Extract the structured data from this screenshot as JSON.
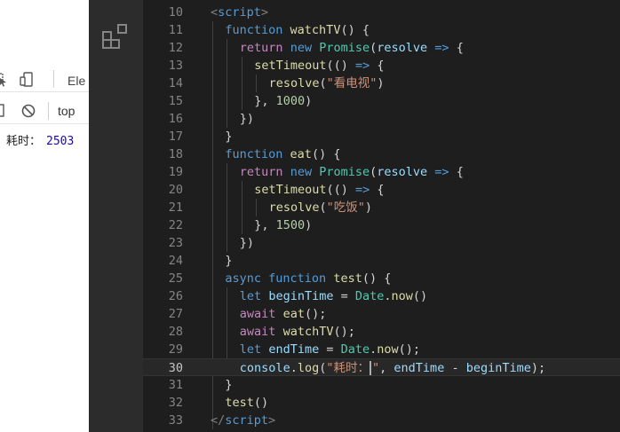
{
  "devtools": {
    "tab_label": "Ele",
    "context_label": "top",
    "console_label": "耗时：",
    "console_value": "2503"
  },
  "editor": {
    "lines": [
      {
        "n": "10",
        "tokens": [
          [
            "tag",
            "<"
          ],
          [
            "tagname",
            "script"
          ],
          [
            "tag",
            ">"
          ]
        ]
      },
      {
        "n": "11",
        "tokens": [
          [
            "kw",
            "function "
          ],
          [
            "fn",
            "watchTV"
          ],
          [
            "pun",
            "() {"
          ]
        ]
      },
      {
        "n": "12",
        "tokens": [
          [
            "ctrl",
            "return "
          ],
          [
            "kw",
            "new "
          ],
          [
            "cls",
            "Promise"
          ],
          [
            "pun",
            "("
          ],
          [
            "var",
            "resolve"
          ],
          [
            "kw",
            " => "
          ],
          [
            "pun",
            "{"
          ]
        ]
      },
      {
        "n": "13",
        "tokens": [
          [
            "fn",
            "setTimeout"
          ],
          [
            "pun",
            "(() "
          ],
          [
            "kw",
            "=>"
          ],
          [
            "pun",
            " {"
          ]
        ]
      },
      {
        "n": "14",
        "tokens": [
          [
            "fn",
            "resolve"
          ],
          [
            "pun",
            "("
          ],
          [
            "str",
            "\"看电视\""
          ],
          [
            "pun",
            ")"
          ]
        ]
      },
      {
        "n": "15",
        "tokens": [
          [
            "pun",
            "}, "
          ],
          [
            "num",
            "1000"
          ],
          [
            "pun",
            ")"
          ]
        ]
      },
      {
        "n": "16",
        "tokens": [
          [
            "pun",
            "})"
          ]
        ]
      },
      {
        "n": "17",
        "tokens": [
          [
            "pun",
            "}"
          ]
        ]
      },
      {
        "n": "18",
        "tokens": [
          [
            "kw",
            "function "
          ],
          [
            "fn",
            "eat"
          ],
          [
            "pun",
            "() {"
          ]
        ]
      },
      {
        "n": "19",
        "tokens": [
          [
            "ctrl",
            "return "
          ],
          [
            "kw",
            "new "
          ],
          [
            "cls",
            "Promise"
          ],
          [
            "pun",
            "("
          ],
          [
            "var",
            "resolve"
          ],
          [
            "kw",
            " => "
          ],
          [
            "pun",
            "{"
          ]
        ]
      },
      {
        "n": "20",
        "tokens": [
          [
            "fn",
            "setTimeout"
          ],
          [
            "pun",
            "(() "
          ],
          [
            "kw",
            "=>"
          ],
          [
            "pun",
            " {"
          ]
        ]
      },
      {
        "n": "21",
        "tokens": [
          [
            "fn",
            "resolve"
          ],
          [
            "pun",
            "("
          ],
          [
            "str",
            "\"吃饭\""
          ],
          [
            "pun",
            ")"
          ]
        ]
      },
      {
        "n": "22",
        "tokens": [
          [
            "pun",
            "}, "
          ],
          [
            "num",
            "1500"
          ],
          [
            "pun",
            ")"
          ]
        ]
      },
      {
        "n": "23",
        "tokens": [
          [
            "pun",
            "})"
          ]
        ]
      },
      {
        "n": "24",
        "tokens": [
          [
            "pun",
            "}"
          ]
        ]
      },
      {
        "n": "25",
        "tokens": [
          [
            "kw",
            "async function "
          ],
          [
            "fn",
            "test"
          ],
          [
            "pun",
            "() {"
          ]
        ]
      },
      {
        "n": "26",
        "tokens": [
          [
            "kw",
            "let "
          ],
          [
            "var",
            "beginTime"
          ],
          [
            "pun",
            " = "
          ],
          [
            "cls",
            "Date"
          ],
          [
            "pun",
            "."
          ],
          [
            "fn",
            "now"
          ],
          [
            "pun",
            "()"
          ]
        ]
      },
      {
        "n": "27",
        "tokens": [
          [
            "ctrl",
            "await "
          ],
          [
            "fn",
            "eat"
          ],
          [
            "pun",
            "();"
          ]
        ]
      },
      {
        "n": "28",
        "tokens": [
          [
            "ctrl",
            "await "
          ],
          [
            "fn",
            "watchTV"
          ],
          [
            "pun",
            "();"
          ]
        ]
      },
      {
        "n": "29",
        "tokens": [
          [
            "kw",
            "let "
          ],
          [
            "var",
            "endTime"
          ],
          [
            "pun",
            " = "
          ],
          [
            "cls",
            "Date"
          ],
          [
            "pun",
            "."
          ],
          [
            "fn",
            "now"
          ],
          [
            "pun",
            "();"
          ]
        ]
      },
      {
        "n": "30",
        "tokens": [
          [
            "var",
            "console"
          ],
          [
            "pun",
            "."
          ],
          [
            "fn",
            "log"
          ],
          [
            "pun",
            "("
          ],
          [
            "str",
            "\"耗时："
          ],
          [
            "cursor",
            ""
          ],
          [
            "str",
            "\""
          ],
          [
            "pun",
            ", "
          ],
          [
            "var",
            "endTime"
          ],
          [
            "pun",
            " - "
          ],
          [
            "var",
            "beginTime"
          ],
          [
            "pun",
            ");"
          ]
        ]
      },
      {
        "n": "31",
        "tokens": [
          [
            "pun",
            "}"
          ]
        ]
      },
      {
        "n": "32",
        "tokens": [
          [
            "fn",
            "test"
          ],
          [
            "pun",
            "()"
          ]
        ]
      },
      {
        "n": "33",
        "tokens": [
          [
            "tag",
            "</"
          ],
          [
            "tagname",
            "script"
          ],
          [
            "tag",
            ">"
          ]
        ]
      }
    ]
  }
}
